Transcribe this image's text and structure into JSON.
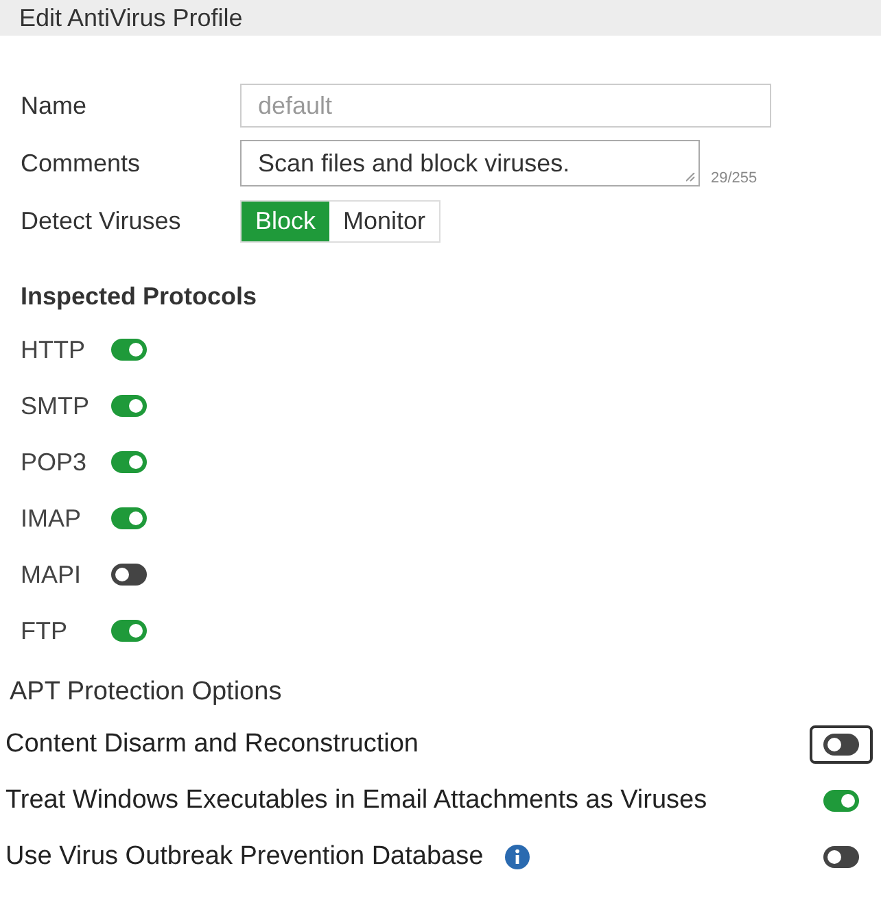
{
  "header": {
    "title": "Edit AntiVirus Profile"
  },
  "form": {
    "name": {
      "label": "Name",
      "value": "default",
      "disabled": true
    },
    "comments": {
      "label": "Comments",
      "value": "Scan files and block viruses.",
      "counter": "29/255"
    },
    "detect": {
      "label": "Detect Viruses",
      "options": [
        {
          "label": "Block",
          "selected": true
        },
        {
          "label": "Monitor",
          "selected": false
        }
      ]
    }
  },
  "protocols": {
    "title": "Inspected Protocols",
    "items": [
      {
        "label": "HTTP",
        "on": true
      },
      {
        "label": "SMTP",
        "on": true
      },
      {
        "label": "POP3",
        "on": true
      },
      {
        "label": "IMAP",
        "on": true
      },
      {
        "label": "MAPI",
        "on": false
      },
      {
        "label": "FTP",
        "on": true
      }
    ]
  },
  "apt": {
    "title": "APT Protection Options",
    "items": [
      {
        "label": "Content Disarm and Reconstruction",
        "on": false,
        "focused": true,
        "info": false
      },
      {
        "label": "Treat Windows Executables in Email Attachments as Viruses",
        "on": true,
        "focused": false,
        "info": false
      },
      {
        "label": "Use Virus Outbreak Prevention Database",
        "on": false,
        "focused": false,
        "info": true
      }
    ]
  }
}
